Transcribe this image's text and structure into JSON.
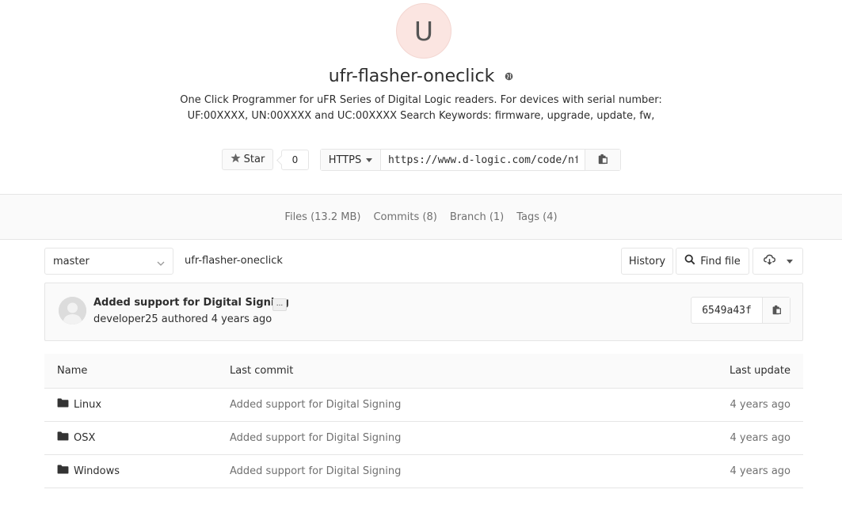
{
  "project": {
    "avatar_letter": "U",
    "title": "ufr-flasher-oneclick",
    "visibility_icon": "globe-icon",
    "description": "One Click Programmer for uFR Series of Digital Logic readers. For devices with serial number: UF:00XXXX, UN:00XXXX and UC:00XXXX Search Keywords: firmware, upgrade, update, fw,"
  },
  "star": {
    "label": "Star",
    "count": "0",
    "icon": "star-icon"
  },
  "clone": {
    "protocol": "HTTPS",
    "url": "https://www.d-logic.com/code/nfc-rfid-reader-sdk/ufr-flasher-oneclick.git",
    "copy_icon": "clipboard-icon"
  },
  "nav": {
    "files": "Files (13.2 MB)",
    "commits": "Commits (8)",
    "branch": "Branch (1)",
    "tags": "Tags (4)"
  },
  "toolbar": {
    "branch": "master",
    "breadcrumb": "ufr-flasher-oneclick",
    "history": "History",
    "find_file": "Find file",
    "download_icon": "cloud-download-icon"
  },
  "last_commit": {
    "title": "Added support for Digital Signing",
    "ellipsis": "...",
    "meta": "developer25 authored 4 years ago",
    "sha": "6549a43f"
  },
  "table": {
    "headers": {
      "name": "Name",
      "last_commit": "Last commit",
      "last_update": "Last update"
    },
    "rows": [
      {
        "name": "Linux",
        "commit": "Added support for Digital Signing",
        "updated": "4 years ago"
      },
      {
        "name": "OSX",
        "commit": "Added support for Digital Signing",
        "updated": "4 years ago"
      },
      {
        "name": "Windows",
        "commit": "Added support for Digital Signing",
        "updated": "4 years ago"
      }
    ]
  },
  "colors": {
    "avatar_bg": "#fbe5e1",
    "border": "#e5e5e5",
    "muted_text": "#707070"
  }
}
